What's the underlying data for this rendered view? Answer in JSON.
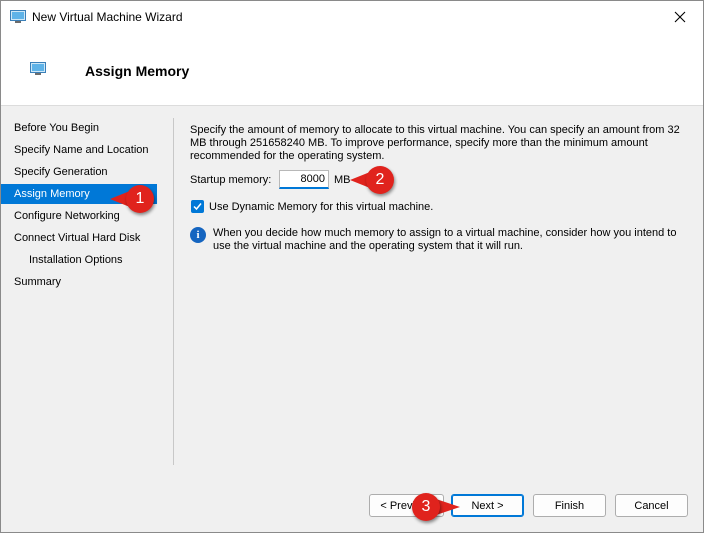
{
  "window": {
    "title": "New Virtual Machine Wizard"
  },
  "header": {
    "title": "Assign Memory"
  },
  "nav": {
    "items": [
      {
        "label": "Before You Begin",
        "selected": false,
        "sub": false
      },
      {
        "label": "Specify Name and Location",
        "selected": false,
        "sub": false
      },
      {
        "label": "Specify Generation",
        "selected": false,
        "sub": false
      },
      {
        "label": "Assign Memory",
        "selected": true,
        "sub": false
      },
      {
        "label": "Configure Networking",
        "selected": false,
        "sub": false
      },
      {
        "label": "Connect Virtual Hard Disk",
        "selected": false,
        "sub": false
      },
      {
        "label": "Installation Options",
        "selected": false,
        "sub": true
      },
      {
        "label": "Summary",
        "selected": false,
        "sub": false
      }
    ]
  },
  "content": {
    "description": "Specify the amount of memory to allocate to this virtual machine. You can specify an amount from 32 MB through 251658240 MB. To improve performance, specify more than the minimum amount recommended for the operating system.",
    "startup_label": "Startup memory:",
    "startup_value": "8000",
    "startup_unit": "MB",
    "dynamic_memory_label": "Use Dynamic Memory for this virtual machine.",
    "dynamic_memory_checked": true,
    "info_text": "When you decide how much memory to assign to a virtual machine, consider how you intend to use the virtual machine and the operating system that it will run."
  },
  "buttons": {
    "previous": "< Previous",
    "next": "Next >",
    "finish": "Finish",
    "cancel": "Cancel"
  },
  "callouts": [
    "1",
    "2",
    "3"
  ],
  "colors": {
    "accent": "#0078d7",
    "callout": "#e0231d"
  }
}
